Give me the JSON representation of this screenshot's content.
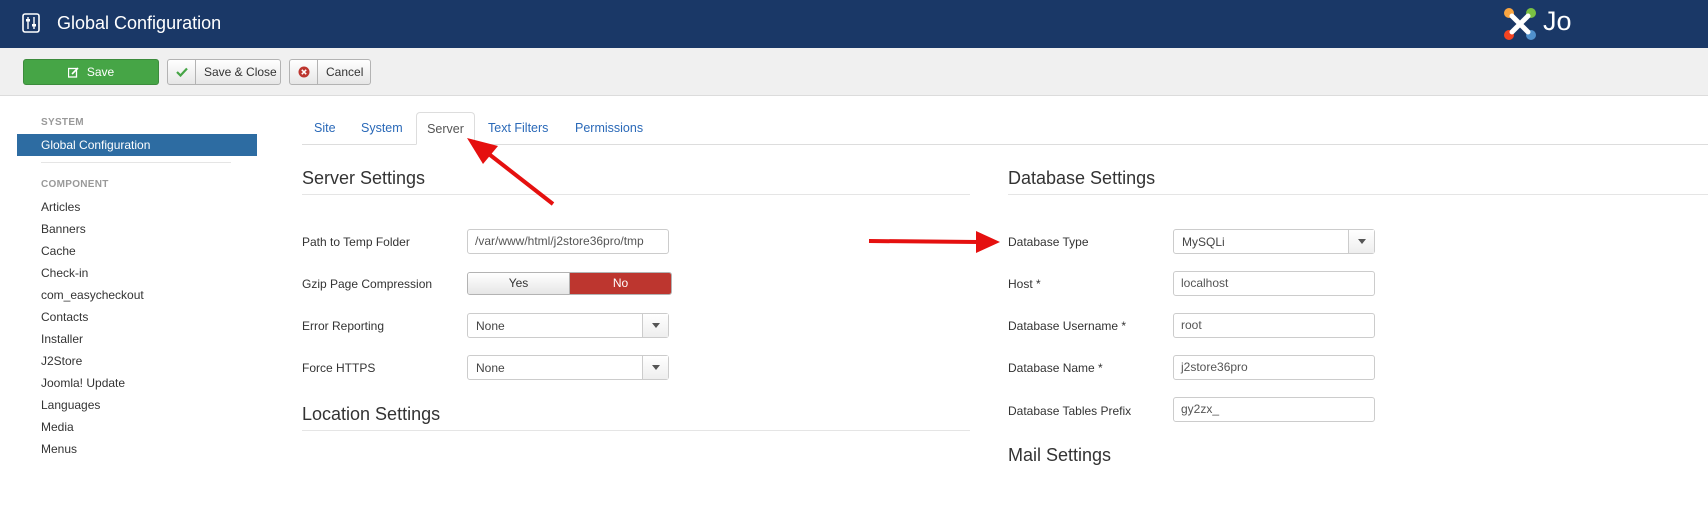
{
  "header": {
    "title": "Global Configuration",
    "logo_text": "Jo"
  },
  "toolbar": {
    "save_label": "Save",
    "save_close_label": "Save & Close",
    "cancel_label": "Cancel"
  },
  "sidebar": {
    "system_heading": "SYSTEM",
    "active_item": "Global Configuration",
    "component_heading": "COMPONENT",
    "items": [
      "Articles",
      "Banners",
      "Cache",
      "Check-in",
      "com_easycheckout",
      "Contacts",
      "Installer",
      "J2Store",
      "Joomla! Update",
      "Languages",
      "Media",
      "Menus"
    ]
  },
  "tabs": [
    "Site",
    "System",
    "Server",
    "Text Filters",
    "Permissions"
  ],
  "active_tab": "Server",
  "server": {
    "title": "Server Settings",
    "temp_label": "Path to Temp Folder",
    "temp_value": "/var/www/html/j2store36pro/tmp",
    "gzip_label": "Gzip Page Compression",
    "gzip_yes": "Yes",
    "gzip_no": "No",
    "error_label": "Error Reporting",
    "error_value": "None",
    "https_label": "Force HTTPS",
    "https_value": "None"
  },
  "location": {
    "title": "Location Settings"
  },
  "database": {
    "title": "Database Settings",
    "type_label": "Database Type",
    "type_value": "MySQLi",
    "host_label": "Host *",
    "host_value": "localhost",
    "user_label": "Database Username *",
    "user_value": "root",
    "name_label": "Database Name *",
    "name_value": "j2store36pro",
    "prefix_label": "Database Tables Prefix",
    "prefix_value": "gy2zx_"
  },
  "mail": {
    "title": "Mail Settings"
  },
  "colors": {
    "header": "#1a3867",
    "save": "#46a546",
    "active": "#2d6ca2",
    "no": "#bd362f",
    "arrow": "#e5100f"
  }
}
